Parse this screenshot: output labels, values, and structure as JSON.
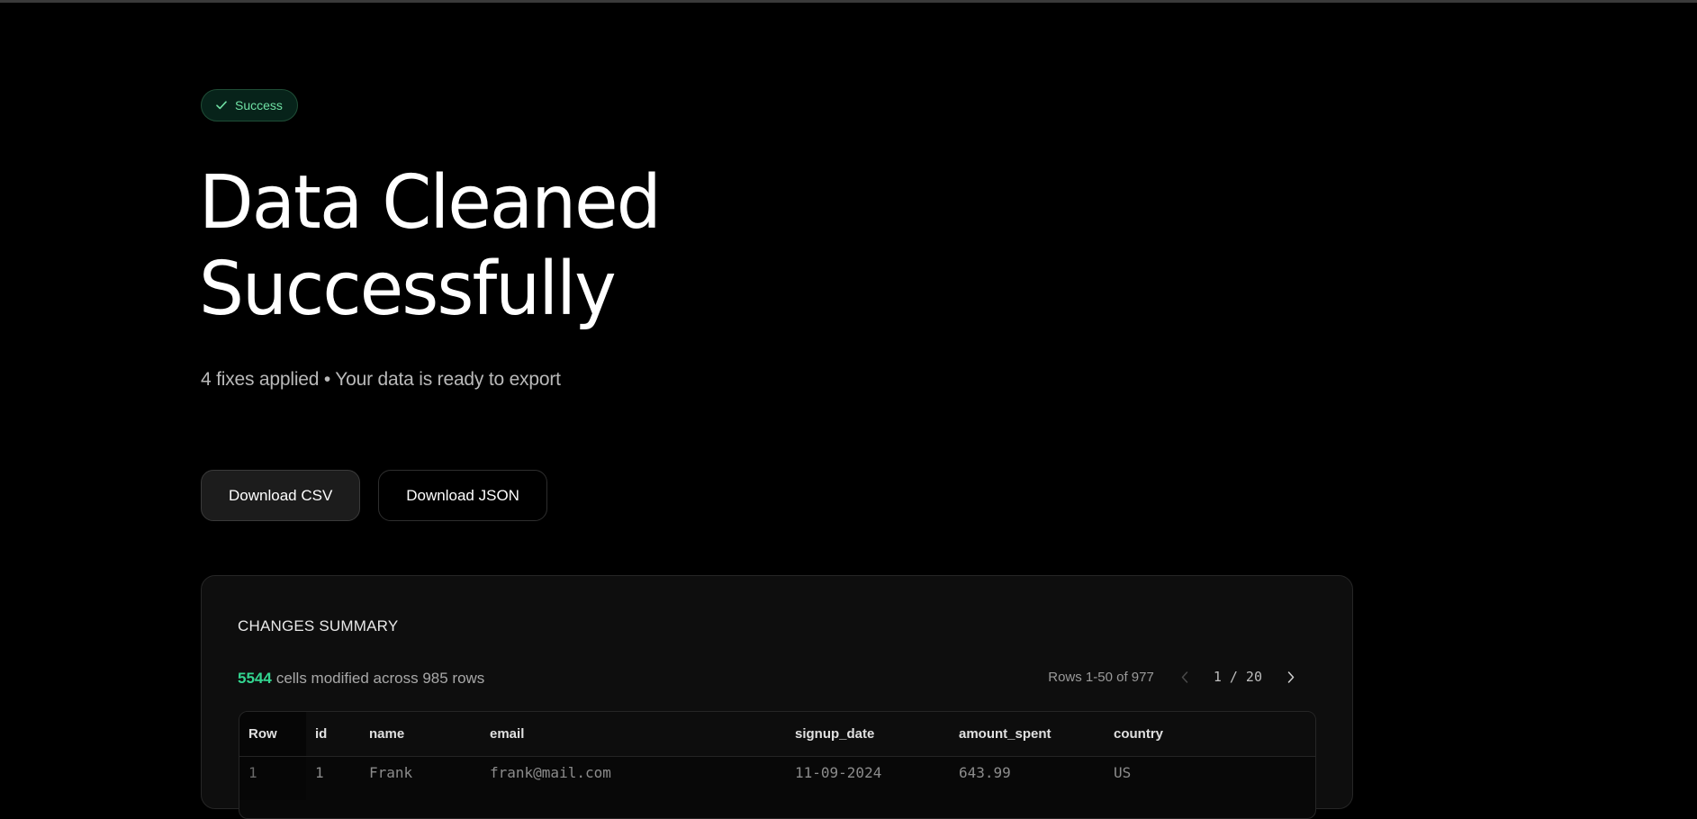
{
  "badge": {
    "label": "Success",
    "icon": "check-icon",
    "color": "#6fe0a4"
  },
  "hero": {
    "title_line1": "Data Cleaned",
    "title_line2": "Successfully",
    "subtitle": "4 fixes applied • Your data is ready to export"
  },
  "actions": {
    "download_csv": "Download CSV",
    "download_json": "Download JSON"
  },
  "changes": {
    "title": "CHANGES SUMMARY",
    "modified_count": "5544",
    "modified_text": "cells modified across 985 rows",
    "accent_color": "#33d590",
    "pagination": {
      "range": "Rows 1-50 of 977",
      "page_info": "1 / 20",
      "prev_icon": "chevron-left-icon",
      "next_icon": "chevron-right-icon"
    },
    "table": {
      "columns": [
        "Row",
        "id",
        "name",
        "email",
        "signup_date",
        "amount_spent",
        "country"
      ],
      "rows": [
        [
          "1",
          "1",
          "Frank",
          "frank@mail.com",
          "11-09-2024",
          "643.99",
          "US"
        ]
      ]
    }
  }
}
